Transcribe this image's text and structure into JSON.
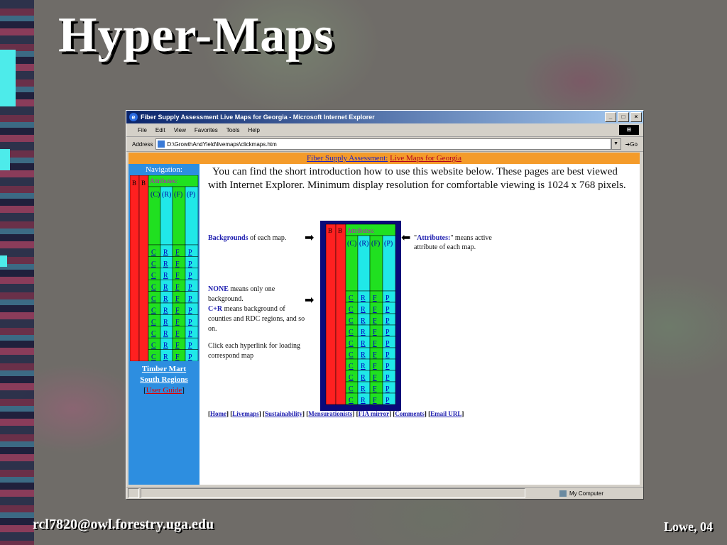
{
  "slide": {
    "title": "Hyper-Maps",
    "footer_left": "rcl7820@owl.forestry.uga.edu",
    "footer_right": "Lowe, 04"
  },
  "window": {
    "title": "Fiber Supply Assessment Live Maps for Georgia - Microsoft Internet Explorer",
    "buttons": [
      "_",
      "□",
      "×"
    ],
    "menu": [
      "File",
      "Edit",
      "View",
      "Favorites",
      "Tools",
      "Help"
    ],
    "address_label": "Address",
    "address_value": "D:\\GrowthAndYield\\livemaps\\clickmaps.htm",
    "go_label": "Go",
    "status_zone": "My Computer"
  },
  "page": {
    "banner_part1": "Fiber Supply Assessment:",
    "banner_part2": "Live Maps for Georgia",
    "nav_heading": "Navigation:",
    "nav_links": [
      "Timber Mart",
      "South Regions"
    ],
    "user_guide": "User Guide",
    "intro": "You can find the short introduction how to use this website below. These pages are best viewed with Internet Explorer. Minimum display resolution for comfortable viewing is 1024 x 768 pixels.",
    "note_backgrounds_term": "Backgrounds",
    "note_backgrounds_rest": " of each map.",
    "note_none_term": "NONE",
    "note_none_rest": " means only one background.",
    "note_cr_term": "C+R",
    "note_cr_rest": " means background of counties and RDC regions, and so on.",
    "note_click": "Click each hyperlink for loading correspond map",
    "note_attr_term": "Attributes:",
    "note_attr_rest": " means active attribute of each map.",
    "bottom_links": [
      "Home",
      "Livemaps",
      "Sustainability",
      "Mensurationists",
      "FIA mirror",
      "Comments",
      "Email URL"
    ],
    "attributes_label": "Attributes:"
  },
  "colors": {
    "nav_bg": "#2d8ee0",
    "banner_bg": "#f49b2a",
    "red": "#ff2020",
    "green": "#20e020",
    "cyan": "#20e8e8",
    "purple": "#8a20c8"
  }
}
